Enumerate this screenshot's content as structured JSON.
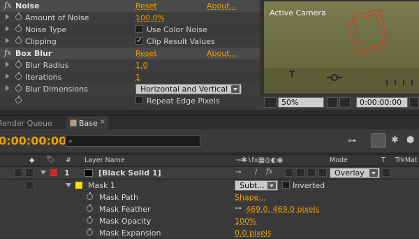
{
  "effects": {
    "noise": {
      "title": "Noise",
      "reset": "Reset",
      "about": "About...",
      "amount_label": "Amount of Noise",
      "amount_value": "100.0%",
      "type_label": "Noise Type",
      "type_checkbox": "Use Color Noise",
      "type_checked": false,
      "clipping_label": "Clipping",
      "clipping_checkbox": "Clip Result Values",
      "clipping_checked": true
    },
    "box_blur": {
      "title": "Box Blur",
      "reset": "Reset",
      "about": "About...",
      "radius_label": "Blur Radius",
      "radius_value": "1.0",
      "iterations_label": "Iterations",
      "iterations_value": "1",
      "dimensions_label": "Blur Dimensions",
      "dimensions_value": "Horizontal and Vertical",
      "repeat_checkbox": "Repeat Edge Pixels",
      "repeat_checked": false
    }
  },
  "viewer": {
    "title": "Active Camera",
    "zoom": "50%",
    "timecode": "0:00:00:00"
  },
  "timeline": {
    "tabs": [
      "Render Queue",
      "Base"
    ],
    "timecode": "0:00:00:00",
    "columns": {
      "num": "#",
      "layer_name": "Layer Name",
      "mode": "Mode",
      "t": "T",
      "trkmat": "TrkMat"
    },
    "layer": {
      "number": "1",
      "name": "[Black Solid 1]",
      "label_color": "#c22e2e",
      "mode": "Overlay"
    },
    "mask": {
      "name": "Mask 1",
      "label_color": "#f2e400",
      "mode": "Subt...",
      "inverted_label": "Inverted",
      "inverted_checked": false,
      "props": [
        {
          "label": "Mask Path",
          "value": "Shape..."
        },
        {
          "label": "Mask Feather",
          "value": "469.0, 469.0 pixels"
        },
        {
          "label": "Mask Opacity",
          "value": "100%"
        },
        {
          "label": "Mask Expansion",
          "value": "0.0 pixels"
        }
      ]
    }
  },
  "colors": {
    "accent": "#e9a000",
    "panel": "#3a3a3a"
  }
}
